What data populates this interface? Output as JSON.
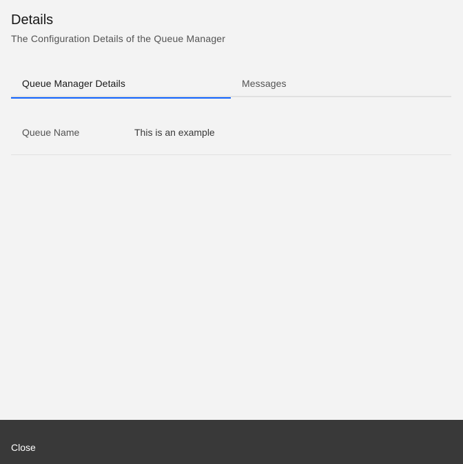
{
  "dialog": {
    "title": "Details",
    "subtitle": "The Configuration Details of the Queue Manager"
  },
  "tabs": [
    {
      "label": "Queue Manager Details",
      "selected": true
    },
    {
      "label": "Messages",
      "selected": false
    }
  ],
  "details": {
    "rows": [
      {
        "key": "Queue Name",
        "value": "This is an example"
      }
    ]
  },
  "footer": {
    "close_label": "Close"
  },
  "colors": {
    "background": "#f3f3f3",
    "footer": "#393939",
    "active_tab_indicator": "#0f62fe"
  }
}
